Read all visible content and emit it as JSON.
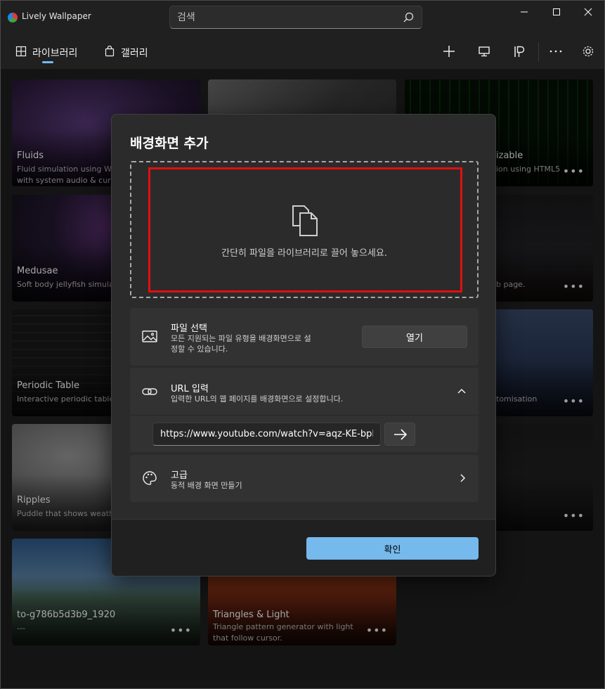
{
  "app": {
    "title": "Lively Wallpaper"
  },
  "search": {
    "placeholder": "검색"
  },
  "nav": {
    "library": "라이브러리",
    "gallery": "갤러리"
  },
  "cards": [
    {
      "title": "Fluids",
      "desc": "Fluid simulation using W\nwith system audio & cur"
    },
    {
      "title": "",
      "desc": ""
    },
    {
      "title": "izable",
      "desc": "ion using HTML5"
    },
    {
      "title": "Medusae",
      "desc": "Soft body jellyfish simula"
    },
    {
      "title": "",
      "desc": ""
    },
    {
      "title": "",
      "desc": "b page."
    },
    {
      "title": "Periodic Table",
      "desc": "Interactive periodic table"
    },
    {
      "title": "",
      "desc": ""
    },
    {
      "title": "",
      "desc": "tomisation"
    },
    {
      "title": "Ripples",
      "desc": "Puddle that shows weath"
    },
    {
      "title": "",
      "desc": ""
    },
    {
      "title": "",
      "desc": ""
    },
    {
      "title": "to-g786b5d3b9_1920",
      "desc": "---"
    },
    {
      "title": "Triangles & Light",
      "desc": "Triangle pattern generator with light\nthat follow cursor."
    }
  ],
  "dialog": {
    "title": "배경화면 추가",
    "drop_text": "간단히 파일을 라이브러리로 끌어 놓으세요.",
    "file": {
      "title": "파일 선택",
      "desc": "모든 지원되는 파일 유형을 배경화면으로 설\n정할 수 있습니다.",
      "button": "열기"
    },
    "url": {
      "title": "URL 입력",
      "desc": "입력한 URL의 웹 페이지를 배경화면으로 설정합니다.",
      "value": "https://www.youtube.com/watch?v=aqz-KE-bpKQ"
    },
    "advanced": {
      "title": "고급",
      "desc": "동적 배경 화면 만들기"
    },
    "ok": "확인"
  }
}
